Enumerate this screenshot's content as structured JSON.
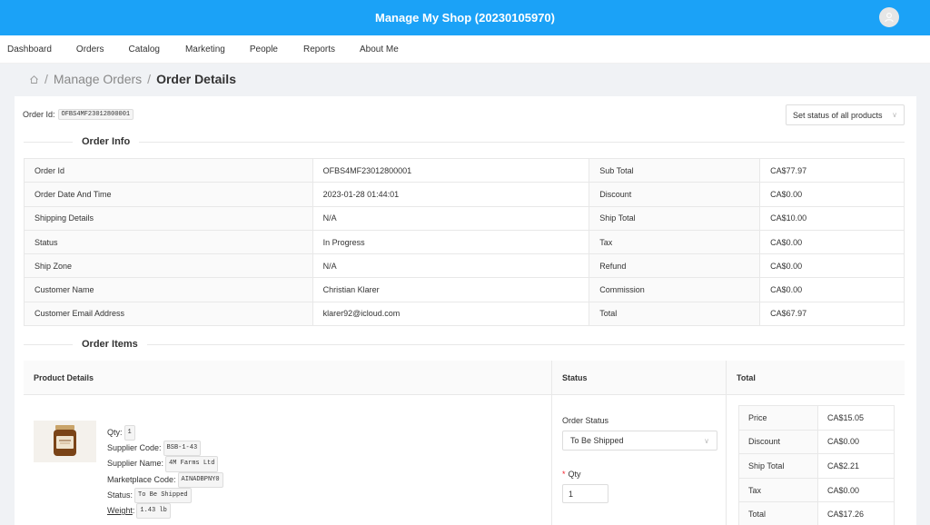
{
  "header": {
    "title": "Manage My Shop (20230105970)"
  },
  "nav": [
    "Dashboard",
    "Orders",
    "Catalog",
    "Marketing",
    "People",
    "Reports",
    "About Me"
  ],
  "breadcrumb": {
    "sep": "/",
    "parent": "Manage Orders",
    "current": "Order Details"
  },
  "order": {
    "id_label": "Order Id:",
    "id_value": "OFBS4MF23012800001",
    "set_status_label": "Set status of all products"
  },
  "sections": {
    "order_info": "Order Info",
    "order_items": "Order Items"
  },
  "order_info": [
    {
      "label": "Order Id",
      "value": "OFBS4MF23012800001",
      "label2": "Sub Total",
      "value2": "CA$77.97"
    },
    {
      "label": "Order Date And Time",
      "value": "2023-01-28 01:44:01",
      "label2": "Discount",
      "value2": "CA$0.00"
    },
    {
      "label": "Shipping Details",
      "value": "N/A",
      "label2": "Ship Total",
      "value2": "CA$10.00"
    },
    {
      "label": "Status",
      "value": "In Progress",
      "label2": "Tax",
      "value2": "CA$0.00"
    },
    {
      "label": "Ship Zone",
      "value": "N/A",
      "label2": "Refund",
      "value2": "CA$0.00"
    },
    {
      "label": "Customer Name",
      "value": "Christian Klarer",
      "label2": "Commission",
      "value2": "CA$0.00"
    },
    {
      "label": "Customer Email Address",
      "value": "klarer92@icloud.com",
      "label2": "Total",
      "value2": "CA$67.97"
    }
  ],
  "items_table": {
    "headers": [
      "Product Details",
      "Status",
      "Total"
    ],
    "product": {
      "qty_label": "Qty:",
      "qty": "1",
      "supplier_code_label": "Supplier Code:",
      "supplier_code": "BSB-1-43",
      "supplier_name_label": "Supplier Name:",
      "supplier_name": "4M Farms Ltd",
      "marketplace_code_label": "Marketplace Code:",
      "marketplace_code": "AINADBPNY0",
      "status_label": "Status:",
      "status": "To Be Shipped",
      "weight_label": "Weight",
      "weight_colon": ":",
      "weight": "1.43 lb"
    },
    "status": {
      "order_status_label": "Order Status",
      "order_status_value": "To Be Shipped",
      "qty_required": "*",
      "qty_label": "Qty",
      "qty_value": "1"
    },
    "totals": [
      {
        "label": "Price",
        "value": "CA$15.05"
      },
      {
        "label": "Discount",
        "value": "CA$0.00"
      },
      {
        "label": "Ship Total",
        "value": "CA$2.21"
      },
      {
        "label": "Tax",
        "value": "CA$0.00"
      },
      {
        "label": "Total",
        "value": "CA$17.26"
      }
    ]
  },
  "colors": {
    "topbar": "#1ba2f7",
    "required": "#f5222d"
  },
  "icons": {
    "avatar": "user-icon",
    "home": "home-icon",
    "dropdown": "chevron-down-icon"
  }
}
